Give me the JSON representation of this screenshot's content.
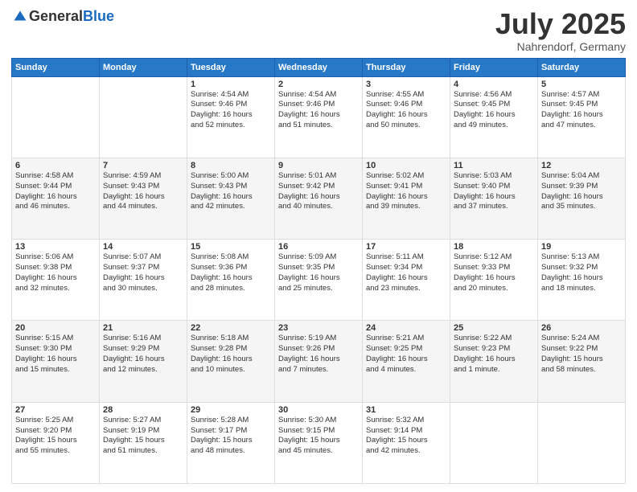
{
  "header": {
    "logo_general": "General",
    "logo_blue": "Blue",
    "month_title": "July 2025",
    "location": "Nahrendorf, Germany"
  },
  "days_of_week": [
    "Sunday",
    "Monday",
    "Tuesday",
    "Wednesday",
    "Thursday",
    "Friday",
    "Saturday"
  ],
  "weeks": [
    [
      {
        "day": "",
        "info": ""
      },
      {
        "day": "",
        "info": ""
      },
      {
        "day": "1",
        "info": "Sunrise: 4:54 AM\nSunset: 9:46 PM\nDaylight: 16 hours\nand 52 minutes."
      },
      {
        "day": "2",
        "info": "Sunrise: 4:54 AM\nSunset: 9:46 PM\nDaylight: 16 hours\nand 51 minutes."
      },
      {
        "day": "3",
        "info": "Sunrise: 4:55 AM\nSunset: 9:46 PM\nDaylight: 16 hours\nand 50 minutes."
      },
      {
        "day": "4",
        "info": "Sunrise: 4:56 AM\nSunset: 9:45 PM\nDaylight: 16 hours\nand 49 minutes."
      },
      {
        "day": "5",
        "info": "Sunrise: 4:57 AM\nSunset: 9:45 PM\nDaylight: 16 hours\nand 47 minutes."
      }
    ],
    [
      {
        "day": "6",
        "info": "Sunrise: 4:58 AM\nSunset: 9:44 PM\nDaylight: 16 hours\nand 46 minutes."
      },
      {
        "day": "7",
        "info": "Sunrise: 4:59 AM\nSunset: 9:43 PM\nDaylight: 16 hours\nand 44 minutes."
      },
      {
        "day": "8",
        "info": "Sunrise: 5:00 AM\nSunset: 9:43 PM\nDaylight: 16 hours\nand 42 minutes."
      },
      {
        "day": "9",
        "info": "Sunrise: 5:01 AM\nSunset: 9:42 PM\nDaylight: 16 hours\nand 40 minutes."
      },
      {
        "day": "10",
        "info": "Sunrise: 5:02 AM\nSunset: 9:41 PM\nDaylight: 16 hours\nand 39 minutes."
      },
      {
        "day": "11",
        "info": "Sunrise: 5:03 AM\nSunset: 9:40 PM\nDaylight: 16 hours\nand 37 minutes."
      },
      {
        "day": "12",
        "info": "Sunrise: 5:04 AM\nSunset: 9:39 PM\nDaylight: 16 hours\nand 35 minutes."
      }
    ],
    [
      {
        "day": "13",
        "info": "Sunrise: 5:06 AM\nSunset: 9:38 PM\nDaylight: 16 hours\nand 32 minutes."
      },
      {
        "day": "14",
        "info": "Sunrise: 5:07 AM\nSunset: 9:37 PM\nDaylight: 16 hours\nand 30 minutes."
      },
      {
        "day": "15",
        "info": "Sunrise: 5:08 AM\nSunset: 9:36 PM\nDaylight: 16 hours\nand 28 minutes."
      },
      {
        "day": "16",
        "info": "Sunrise: 5:09 AM\nSunset: 9:35 PM\nDaylight: 16 hours\nand 25 minutes."
      },
      {
        "day": "17",
        "info": "Sunrise: 5:11 AM\nSunset: 9:34 PM\nDaylight: 16 hours\nand 23 minutes."
      },
      {
        "day": "18",
        "info": "Sunrise: 5:12 AM\nSunset: 9:33 PM\nDaylight: 16 hours\nand 20 minutes."
      },
      {
        "day": "19",
        "info": "Sunrise: 5:13 AM\nSunset: 9:32 PM\nDaylight: 16 hours\nand 18 minutes."
      }
    ],
    [
      {
        "day": "20",
        "info": "Sunrise: 5:15 AM\nSunset: 9:30 PM\nDaylight: 16 hours\nand 15 minutes."
      },
      {
        "day": "21",
        "info": "Sunrise: 5:16 AM\nSunset: 9:29 PM\nDaylight: 16 hours\nand 12 minutes."
      },
      {
        "day": "22",
        "info": "Sunrise: 5:18 AM\nSunset: 9:28 PM\nDaylight: 16 hours\nand 10 minutes."
      },
      {
        "day": "23",
        "info": "Sunrise: 5:19 AM\nSunset: 9:26 PM\nDaylight: 16 hours\nand 7 minutes."
      },
      {
        "day": "24",
        "info": "Sunrise: 5:21 AM\nSunset: 9:25 PM\nDaylight: 16 hours\nand 4 minutes."
      },
      {
        "day": "25",
        "info": "Sunrise: 5:22 AM\nSunset: 9:23 PM\nDaylight: 16 hours\nand 1 minute."
      },
      {
        "day": "26",
        "info": "Sunrise: 5:24 AM\nSunset: 9:22 PM\nDaylight: 15 hours\nand 58 minutes."
      }
    ],
    [
      {
        "day": "27",
        "info": "Sunrise: 5:25 AM\nSunset: 9:20 PM\nDaylight: 15 hours\nand 55 minutes."
      },
      {
        "day": "28",
        "info": "Sunrise: 5:27 AM\nSunset: 9:19 PM\nDaylight: 15 hours\nand 51 minutes."
      },
      {
        "day": "29",
        "info": "Sunrise: 5:28 AM\nSunset: 9:17 PM\nDaylight: 15 hours\nand 48 minutes."
      },
      {
        "day": "30",
        "info": "Sunrise: 5:30 AM\nSunset: 9:15 PM\nDaylight: 15 hours\nand 45 minutes."
      },
      {
        "day": "31",
        "info": "Sunrise: 5:32 AM\nSunset: 9:14 PM\nDaylight: 15 hours\nand 42 minutes."
      },
      {
        "day": "",
        "info": ""
      },
      {
        "day": "",
        "info": ""
      }
    ]
  ]
}
